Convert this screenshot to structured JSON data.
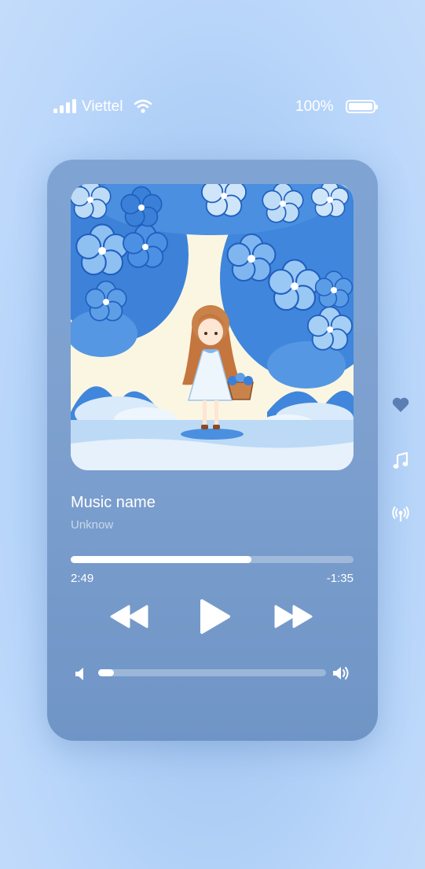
{
  "status_bar": {
    "carrier": "Viettel",
    "battery_percent": "100%",
    "battery_level": 1.0,
    "signal_bars": 4
  },
  "track": {
    "title": "Music name",
    "artist": "Unknow"
  },
  "playback": {
    "elapsed": "2:49",
    "remaining": "-1:35",
    "progress": 0.64
  },
  "volume": {
    "level": 0.07
  },
  "controls": [
    "rewind-icon",
    "play-icon",
    "fast-forward-icon"
  ],
  "side_actions": [
    "heart-icon",
    "music-note-icon",
    "broadcast-icon"
  ],
  "colors": {
    "background": "#b9d6fa",
    "panel": "#7da0cf",
    "accent": "#ffffff"
  }
}
